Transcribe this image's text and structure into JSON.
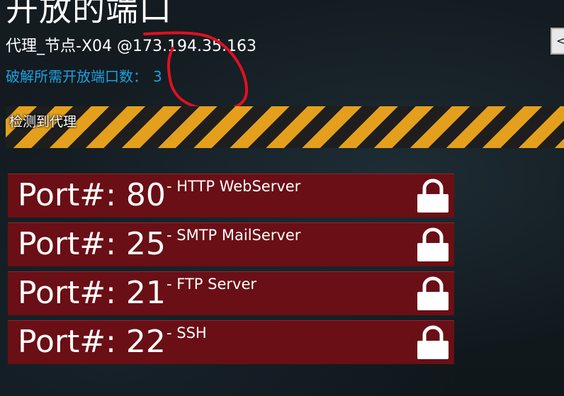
{
  "header": {
    "title": "开放的端口",
    "target": "代理_节点-X04 @173.194.35.163",
    "ports_required_label": "破解所需开放端口数：",
    "ports_required_count": "3"
  },
  "back_button": {
    "icon": "chevron-left-icon",
    "glyph": "<"
  },
  "warning": {
    "label": "检测到代理",
    "colors": {
      "stripe": "#e4a01c",
      "stripe_alt": "#1e1e1e"
    }
  },
  "ports": [
    {
      "port_label": "Port#: 80",
      "service": "- HTTP WebServer",
      "icon": "lock-icon"
    },
    {
      "port_label": "Port#: 25",
      "service": "- SMTP MailServer",
      "icon": "lock-icon"
    },
    {
      "port_label": "Port#: 21",
      "service": "- FTP Server",
      "icon": "lock-icon"
    },
    {
      "port_label": "Port#: 22",
      "service": "- SSH",
      "icon": "lock-icon"
    }
  ],
  "colors": {
    "background": "#131b20",
    "accent_blue": "#1ea0e0",
    "port_row": "#6a0f15",
    "annotation_red": "#e01020"
  }
}
